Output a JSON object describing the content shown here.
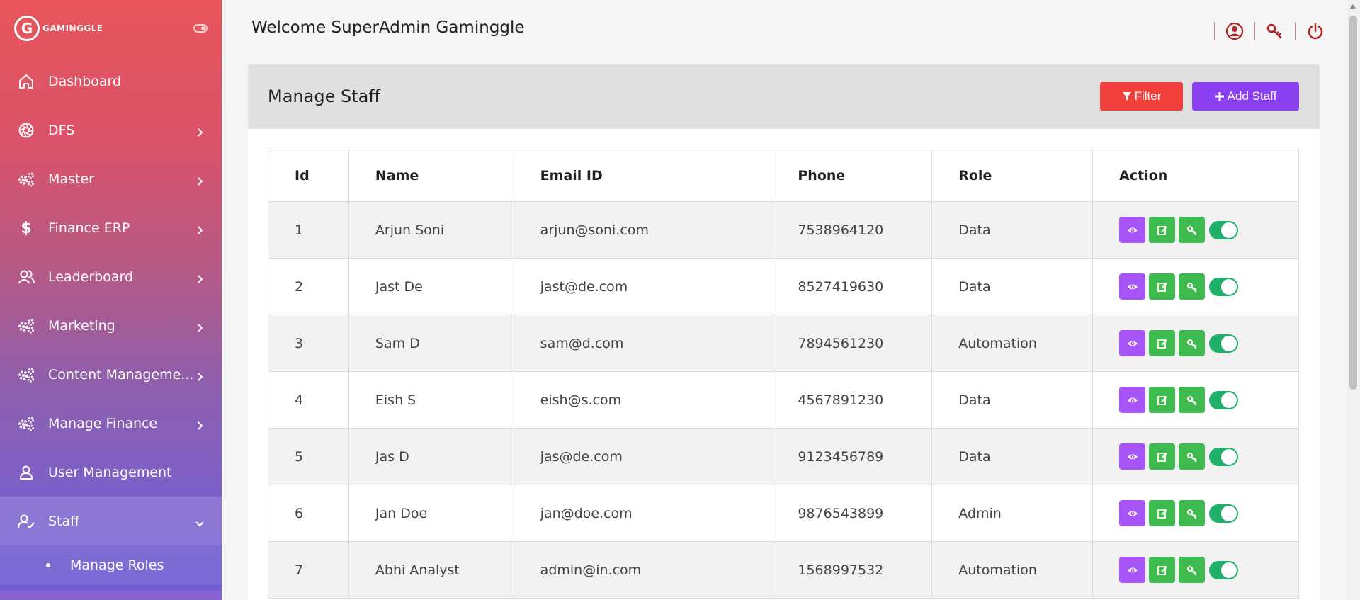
{
  "brand": {
    "name": "GAMINGGLE",
    "logo_letter": "G"
  },
  "sidebar": {
    "items": [
      {
        "label": "Dashboard",
        "icon": "home-icon",
        "has_chevron": false
      },
      {
        "label": "DFS",
        "icon": "aperture-icon",
        "has_chevron": true
      },
      {
        "label": "Master",
        "icon": "gears-icon",
        "has_chevron": true
      },
      {
        "label": "Finance ERP",
        "icon": "dollar-icon",
        "has_chevron": true
      },
      {
        "label": "Leaderboard",
        "icon": "users-icon",
        "has_chevron": true
      },
      {
        "label": "Marketing",
        "icon": "gears-icon",
        "has_chevron": true
      },
      {
        "label": "Content Manageme...",
        "icon": "gears-icon",
        "has_chevron": true
      },
      {
        "label": "Manage Finance",
        "icon": "gears-icon",
        "has_chevron": true
      },
      {
        "label": "User Management",
        "icon": "user-icon",
        "has_chevron": false
      },
      {
        "label": "Staff",
        "icon": "user-check-icon",
        "has_chevron": true,
        "active": true
      }
    ],
    "sub_items": [
      {
        "label": "Manage Roles"
      }
    ]
  },
  "header": {
    "welcome": "Welcome SuperAdmin Gaminggle",
    "icons": [
      "user-circle-icon",
      "key-icon",
      "power-icon"
    ]
  },
  "page": {
    "title": "Manage Staff",
    "filter_label": "Filter",
    "add_label": "Add Staff"
  },
  "table": {
    "columns": [
      "Id",
      "Name",
      "Email ID",
      "Phone",
      "Role",
      "Action"
    ],
    "rows": [
      {
        "id": "1",
        "name": "Arjun Soni",
        "email": "arjun@soni.com",
        "phone": "7538964120",
        "role": "Data",
        "active": true
      },
      {
        "id": "2",
        "name": "Jast De",
        "email": "jast@de.com",
        "phone": "8527419630",
        "role": "Data",
        "active": true
      },
      {
        "id": "3",
        "name": "Sam D",
        "email": "sam@d.com",
        "phone": "7894561230",
        "role": "Automation",
        "active": true
      },
      {
        "id": "4",
        "name": "Eish S",
        "email": "eish@s.com",
        "phone": "4567891230",
        "role": "Data",
        "active": true
      },
      {
        "id": "5",
        "name": "Jas D",
        "email": "jas@de.com",
        "phone": "9123456789",
        "role": "Data",
        "active": true
      },
      {
        "id": "6",
        "name": "Jan Doe",
        "email": "jan@doe.com",
        "phone": "9876543899",
        "role": "Admin",
        "active": true
      },
      {
        "id": "7",
        "name": "Abhi Analyst",
        "email": "admin@in.com",
        "phone": "1568997532",
        "role": "Automation",
        "active": true
      }
    ]
  },
  "colors": {
    "filter_button": "#f2413d",
    "add_button": "#8c3ff0",
    "view_button": "#a855f7",
    "edit_button": "#3fba4f",
    "toggle_on": "#1fb06a",
    "header_icon": "#b22222"
  }
}
